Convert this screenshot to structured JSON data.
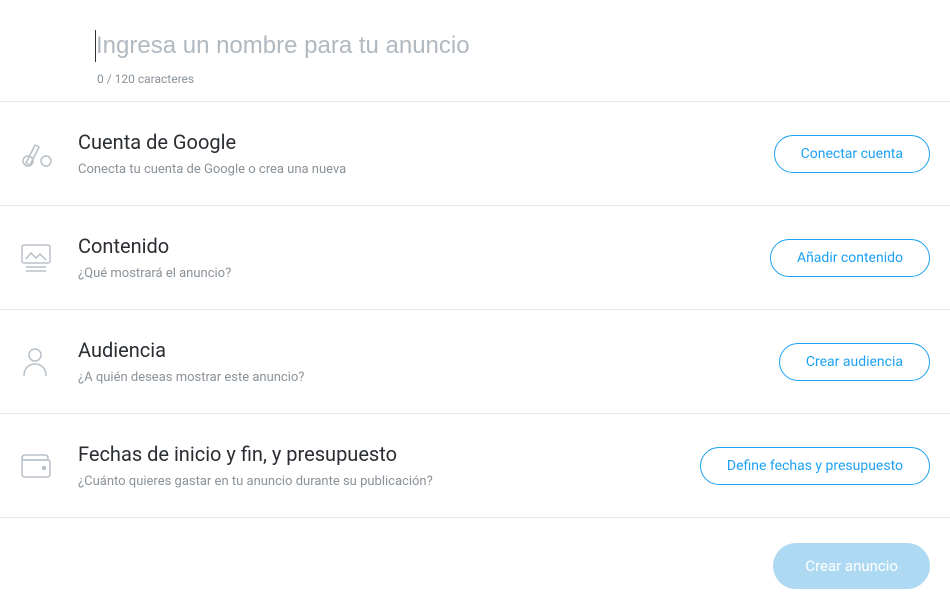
{
  "header": {
    "name_placeholder": "Ingresa un nombre para tu anuncio",
    "name_value": "",
    "counter": "0 / 120 caracteres"
  },
  "sections": {
    "google": {
      "title": "Cuenta de Google",
      "subtitle": "Conecta tu cuenta de Google o crea una nueva",
      "button": "Conectar cuenta"
    },
    "content": {
      "title": "Contenido",
      "subtitle": "¿Qué mostrará el anuncio?",
      "button": "Añadir contenido"
    },
    "audience": {
      "title": "Audiencia",
      "subtitle": "¿A quién deseas mostrar este anuncio?",
      "button": "Crear audiencia"
    },
    "schedule": {
      "title": "Fechas de inicio y fin, y presupuesto",
      "subtitle": "¿Cuánto quieres gastar en tu anuncio durante su publicación?",
      "button": "Define fechas y presupuesto"
    }
  },
  "footer": {
    "create_button": "Crear anuncio"
  }
}
